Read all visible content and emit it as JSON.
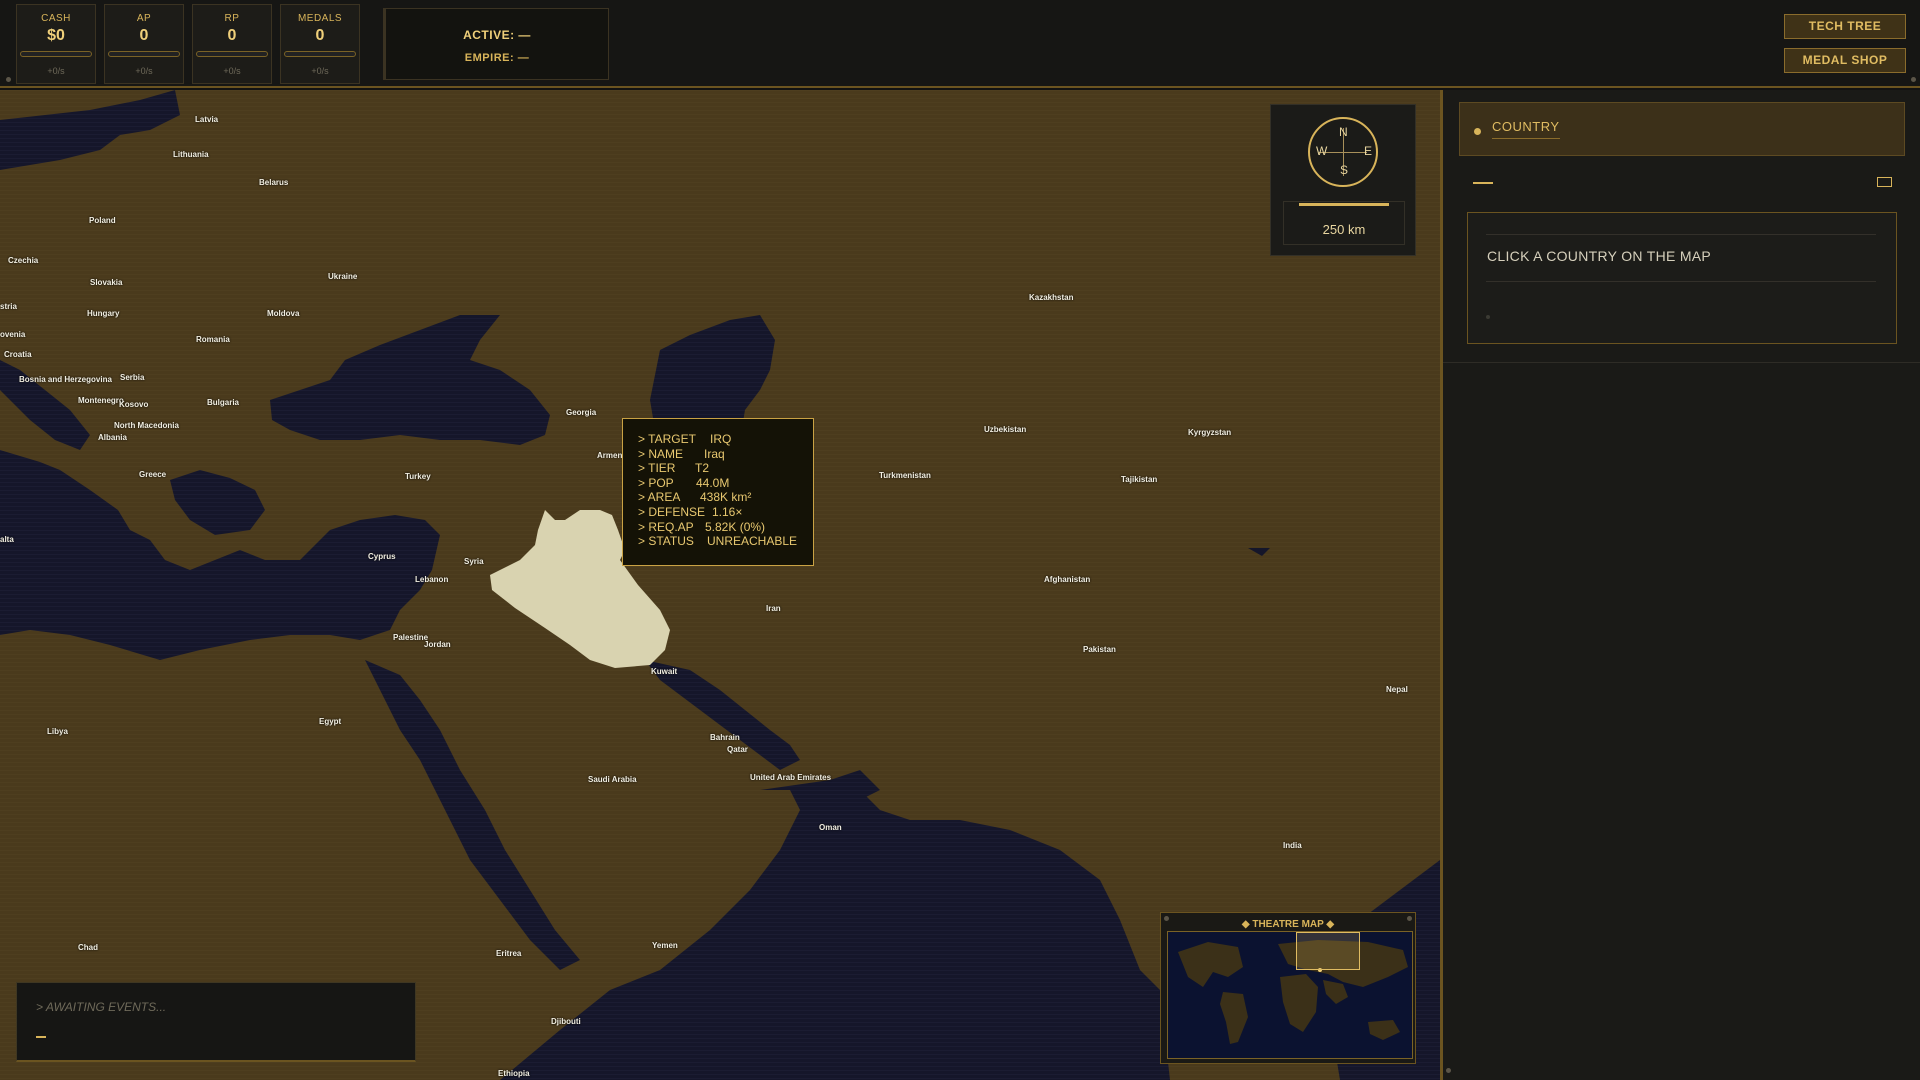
{
  "hud": {
    "stats": [
      {
        "label": "CASH",
        "value": "$0",
        "rate": "+0/s"
      },
      {
        "label": "AP",
        "value": "0",
        "rate": "+0/s"
      },
      {
        "label": "RP",
        "value": "0",
        "rate": "+0/s"
      },
      {
        "label": "MEDALS",
        "value": "0",
        "rate": "+0/s"
      }
    ],
    "status": {
      "active": "ACTIVE: —",
      "empire": "EMPIRE: —"
    },
    "buttons": {
      "tech_tree": "TECH TREE",
      "medal_shop": "MEDAL SHOP"
    }
  },
  "map": {
    "country_labels": [
      "Latvia",
      "Lithuania",
      "Belarus",
      "Poland",
      "Czechia",
      "Slovakia",
      "Ukraine",
      "stria",
      "Hungary",
      "Moldova",
      "ovenia",
      "Romania",
      "Croatia",
      "Bosnia and Herzegovina",
      "Serbia",
      "Montenegro",
      "Kosovo",
      "Bulgaria",
      "North Macedonia",
      "Albania",
      "Greece",
      "Turkey",
      "Georgia",
      "Armenia",
      "Cyprus",
      "Syria",
      "Lebanon",
      "Palestine",
      "Jordan",
      "alta",
      "Libya",
      "Egypt",
      "Kuwait",
      "Iran",
      "Bahrain",
      "Qatar",
      "United Arab Emirates",
      "Saudi Arabia",
      "Oman",
      "Yemen",
      "Eritrea",
      "Djibouti",
      "Chad",
      "Ethiopia",
      "Kazakhstan",
      "Uzbekistan",
      "Kyrgyzstan",
      "Tajikistan",
      "Turkmenistan",
      "Afghanistan",
      "Pakistan",
      "Nepal",
      "India"
    ],
    "compass": {
      "n": "N",
      "s": "S",
      "w": "W",
      "e": "E"
    },
    "scale": "250 km",
    "selected_country": "Iraq",
    "tooltip": [
      {
        "key": "> TARGET",
        "value": "IRQ"
      },
      {
        "key": "> NAME",
        "value": "Iraq"
      },
      {
        "key": "> TIER",
        "value": "T2"
      },
      {
        "key": "> POP",
        "value": "44.0M"
      },
      {
        "key": "> AREA",
        "value": "438K km²"
      },
      {
        "key": "> DEFENSE",
        "value": "1.16×"
      },
      {
        "key": "> REQ.AP",
        "value": "5.82K  (0%)"
      },
      {
        "key": "> STATUS",
        "value": "UNREACHABLE"
      }
    ],
    "event_log": {
      "message": "> AWAITING EVENTS..."
    },
    "theatre_map": {
      "title": "◆ THEATRE MAP ◆"
    }
  },
  "panel": {
    "title": "COUNTRY",
    "prompt": "CLICK A COUNTRY ON THE MAP"
  },
  "colors": {
    "accent": "#d8b45a",
    "land": "#4a3a1c",
    "sea": "#15162a",
    "selected": "#d9d3b0"
  }
}
